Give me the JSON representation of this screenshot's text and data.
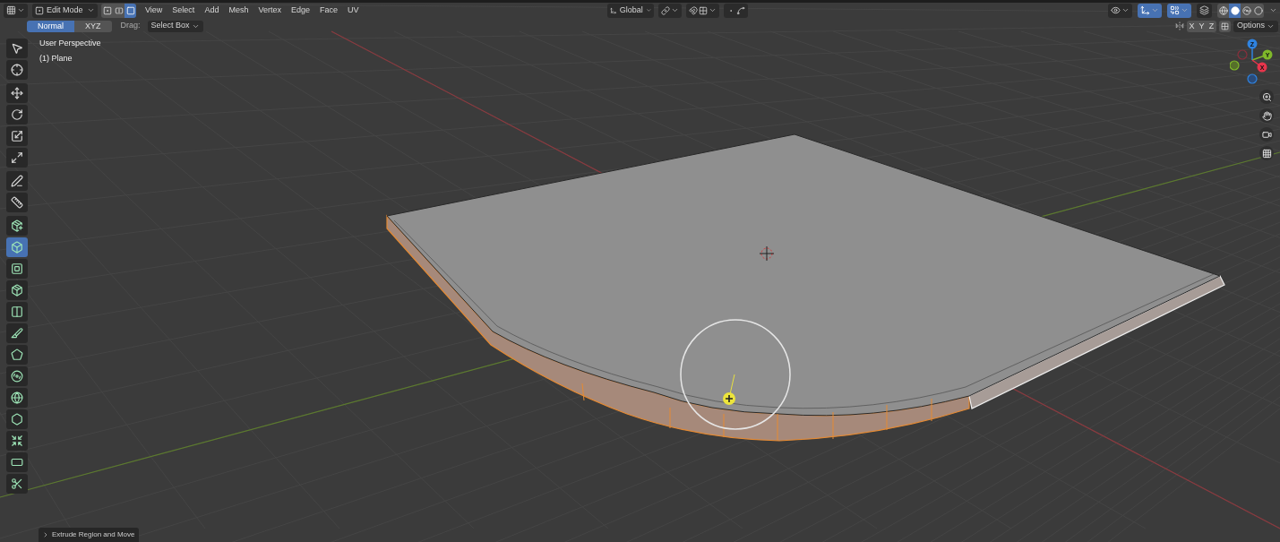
{
  "header": {
    "mode": "Edit Mode",
    "select_modes": [
      {
        "kind": "vertex",
        "selected": false
      },
      {
        "kind": "edge",
        "selected": false
      },
      {
        "kind": "face",
        "selected": true
      }
    ],
    "menus": [
      "View",
      "Select",
      "Add",
      "Mesh",
      "Vertex",
      "Edge",
      "Face",
      "UV"
    ],
    "orientation": "Global",
    "toggles": [
      {
        "kind": "gizmos",
        "on": true
      },
      {
        "kind": "overlays",
        "on": true
      },
      {
        "kind": "xray",
        "on": false
      }
    ],
    "shading_modes": [
      {
        "kind": "wireframe",
        "selected": false
      },
      {
        "kind": "solid",
        "selected": true
      },
      {
        "kind": "material",
        "selected": false
      },
      {
        "kind": "rendered",
        "selected": false
      }
    ]
  },
  "tool_settings": {
    "orientations": [
      {
        "label": "Normal",
        "selected": true
      },
      {
        "label": "XYZ",
        "selected": false
      }
    ],
    "drag_label": "Drag:",
    "drag_value": "Select Box",
    "mirror_axes": [
      {
        "label": "X",
        "selected": false
      },
      {
        "label": "Y",
        "selected": false
      },
      {
        "label": "Z",
        "selected": false
      }
    ],
    "options": "Options"
  },
  "viewport": {
    "view_name": "User Perspective",
    "object_name": "(1) Plane"
  },
  "toolbar": {
    "groups": [
      {
        "tools": [
          {
            "kind": "select",
            "selected": false
          },
          {
            "kind": "cursor",
            "selected": false
          }
        ]
      },
      {
        "tools": [
          {
            "kind": "move",
            "selected": false
          },
          {
            "kind": "rotate",
            "selected": false
          },
          {
            "kind": "scale",
            "selected": false
          },
          {
            "kind": "transform",
            "selected": false
          }
        ]
      },
      {
        "tools": [
          {
            "kind": "annotate",
            "selected": false
          },
          {
            "kind": "measure",
            "selected": false
          }
        ]
      },
      {
        "tools": [
          {
            "kind": "add_cube",
            "selected": false
          },
          {
            "kind": "extrude",
            "selected": true
          },
          {
            "kind": "inset",
            "selected": false
          },
          {
            "kind": "bevel",
            "selected": false
          },
          {
            "kind": "loop_cut",
            "selected": false
          },
          {
            "kind": "knife",
            "selected": false
          },
          {
            "kind": "poly_build",
            "selected": false
          },
          {
            "kind": "spin",
            "selected": false
          },
          {
            "kind": "smooth",
            "selected": false
          },
          {
            "kind": "edge_slide",
            "selected": false
          },
          {
            "kind": "shrink",
            "selected": false
          },
          {
            "kind": "shear",
            "selected": false
          },
          {
            "kind": "rip",
            "selected": false
          }
        ]
      }
    ]
  },
  "gizmo": {
    "axes": [
      "Z",
      "Y",
      "X"
    ]
  },
  "operator_panel": {
    "title": "Extrude Region and Move"
  }
}
